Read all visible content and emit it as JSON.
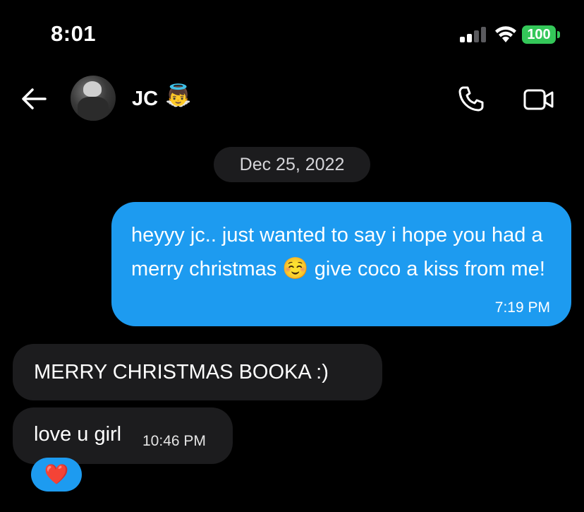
{
  "status_bar": {
    "time": "8:01",
    "battery": "100"
  },
  "header": {
    "contact_name": "JC",
    "contact_emoji": "👼"
  },
  "conversation": {
    "date_separator": "Dec 25, 2022",
    "messages": [
      {
        "direction": "outgoing",
        "text_before_emoji": "heyyy jc.. just wanted to say i hope you had a merry christmas ",
        "emoji": "☺️",
        "text_after_emoji": " give coco a kiss from me!",
        "time": "7:19 PM"
      },
      {
        "direction": "incoming",
        "text": "MERRY CHRISTMAS BOOKA :)"
      },
      {
        "direction": "incoming",
        "text": "love u girl",
        "time": "10:46 PM",
        "reaction": "❤️"
      }
    ]
  },
  "colors": {
    "background": "#000000",
    "outgoing_bubble": "#1d9bf0",
    "incoming_bubble": "#1c1c1e",
    "battery": "#34c759"
  },
  "icons": [
    "back-arrow-icon",
    "phone-icon",
    "video-call-icon",
    "signal-icon",
    "wifi-icon",
    "battery-icon"
  ]
}
